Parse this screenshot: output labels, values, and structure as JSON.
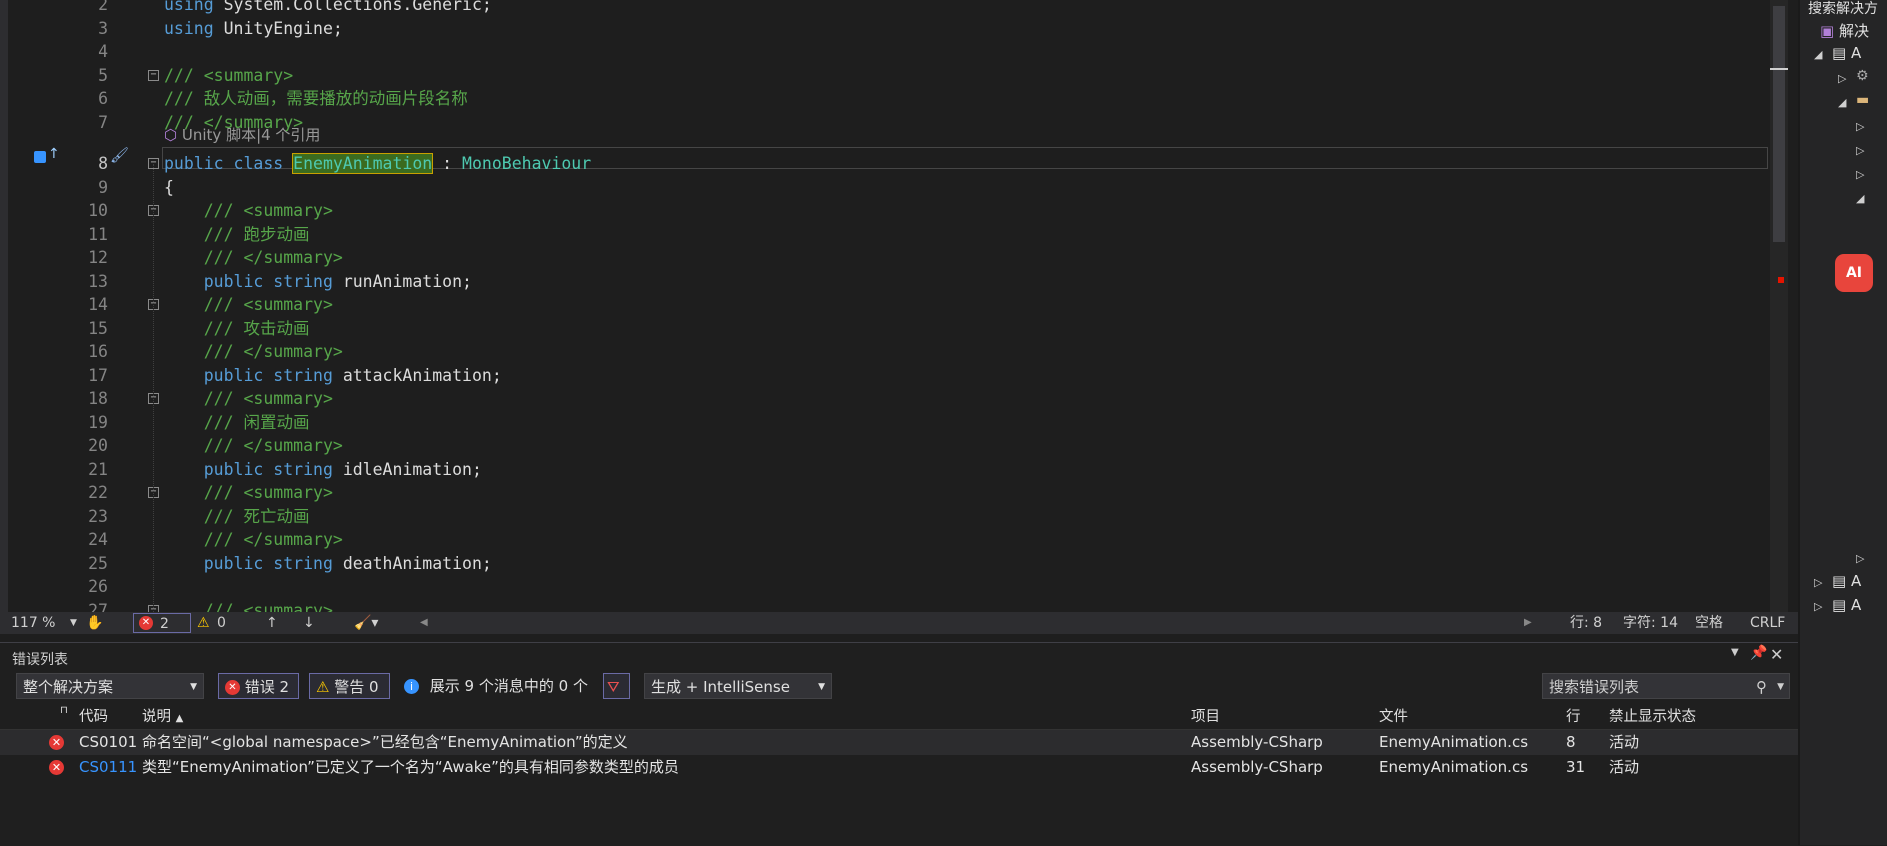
{
  "editor": {
    "codelens": "Unity 脚本|4 个引用",
    "lines": [
      {
        "n": "2",
        "segments": [
          {
            "t": "using ",
            "c": "kw"
          },
          {
            "t": "System.Collections.Generic;",
            "c": ""
          }
        ]
      },
      {
        "n": "3",
        "segments": [
          {
            "t": "using ",
            "c": "kw"
          },
          {
            "t": "UnityEngine;",
            "c": ""
          }
        ]
      },
      {
        "n": "4",
        "segments": []
      },
      {
        "n": "5",
        "segments": [
          {
            "t": "/// <summary>",
            "c": "cm"
          }
        ]
      },
      {
        "n": "6",
        "segments": [
          {
            "t": "/// 敌人动画，需要播放的动画片段名称",
            "c": "cm"
          }
        ]
      },
      {
        "n": "7",
        "segments": [
          {
            "t": "/// </summary>",
            "c": "cm"
          }
        ]
      },
      {
        "n": "8",
        "segments": [
          {
            "t": "public class ",
            "c": "kw"
          },
          {
            "t": "EnemyAnimation",
            "c": "hl"
          },
          {
            "t": " : ",
            "c": ""
          },
          {
            "t": "MonoBehaviour",
            "c": "ty"
          }
        ]
      },
      {
        "n": "9",
        "segments": [
          {
            "t": "{",
            "c": ""
          }
        ]
      },
      {
        "n": "10",
        "segments": [
          {
            "t": "    /// <summary>",
            "c": "cm"
          }
        ]
      },
      {
        "n": "11",
        "segments": [
          {
            "t": "    /// 跑步动画",
            "c": "cm"
          }
        ]
      },
      {
        "n": "12",
        "segments": [
          {
            "t": "    /// </summary>",
            "c": "cm"
          }
        ]
      },
      {
        "n": "13",
        "segments": [
          {
            "t": "    public string ",
            "c": "kw"
          },
          {
            "t": "runAnimation;",
            "c": ""
          }
        ]
      },
      {
        "n": "14",
        "segments": [
          {
            "t": "    /// <summary>",
            "c": "cm"
          }
        ]
      },
      {
        "n": "15",
        "segments": [
          {
            "t": "    /// 攻击动画",
            "c": "cm"
          }
        ]
      },
      {
        "n": "16",
        "segments": [
          {
            "t": "    /// </summary>",
            "c": "cm"
          }
        ]
      },
      {
        "n": "17",
        "segments": [
          {
            "t": "    public string ",
            "c": "kw"
          },
          {
            "t": "attackAnimation;",
            "c": ""
          }
        ]
      },
      {
        "n": "18",
        "segments": [
          {
            "t": "    /// <summary>",
            "c": "cm"
          }
        ]
      },
      {
        "n": "19",
        "segments": [
          {
            "t": "    /// 闲置动画",
            "c": "cm"
          }
        ]
      },
      {
        "n": "20",
        "segments": [
          {
            "t": "    /// </summary>",
            "c": "cm"
          }
        ]
      },
      {
        "n": "21",
        "segments": [
          {
            "t": "    public string ",
            "c": "kw"
          },
          {
            "t": "idleAnimation;",
            "c": ""
          }
        ]
      },
      {
        "n": "22",
        "segments": [
          {
            "t": "    /// <summary>",
            "c": "cm"
          }
        ]
      },
      {
        "n": "23",
        "segments": [
          {
            "t": "    /// 死亡动画",
            "c": "cm"
          }
        ]
      },
      {
        "n": "24",
        "segments": [
          {
            "t": "    /// </summary>",
            "c": "cm"
          }
        ]
      },
      {
        "n": "25",
        "segments": [
          {
            "t": "    public string ",
            "c": "kw"
          },
          {
            "t": "deathAnimation;",
            "c": ""
          }
        ]
      },
      {
        "n": "26",
        "segments": []
      },
      {
        "n": "27",
        "segments": [
          {
            "t": "    /// <summary>",
            "c": "cm"
          }
        ]
      }
    ]
  },
  "statusbar": {
    "zoom": "117 %",
    "errors": "2",
    "warnings": "0",
    "line": "行: 8",
    "char": "字符: 14",
    "whitespace": "空格",
    "eol": "CRLF"
  },
  "errorlist": {
    "title": "错误列表",
    "scope": "整个解决方案",
    "errors_btn": "错误 2",
    "warnings_btn": "警告 0",
    "messages": "展示 9 个消息中的 0 个",
    "build_filter": "生成 + IntelliSense",
    "search_placeholder": "搜索错误列表",
    "columns": [
      "代码",
      "说明",
      "项目",
      "文件",
      "行",
      "禁止显示状态"
    ],
    "rows": [
      {
        "code": "CS0101",
        "desc": "命名空间“<global namespace>”已经包含“EnemyAnimation”的定义",
        "project": "Assembly-CSharp",
        "file": "EnemyAnimation.cs",
        "line": "8",
        "state": "活动",
        "link": false
      },
      {
        "code": "CS0111",
        "desc": "类型“EnemyAnimation”已定义了一个名为“Awake”的具有相同参数类型的成员",
        "project": "Assembly-CSharp",
        "file": "EnemyAnimation.cs",
        "line": "31",
        "state": "活动",
        "link": true
      }
    ]
  },
  "solution": {
    "search": "搜索解决方",
    "root": "解决",
    "items": [
      "A",
      "A",
      "A"
    ]
  },
  "ai_button": "AI"
}
